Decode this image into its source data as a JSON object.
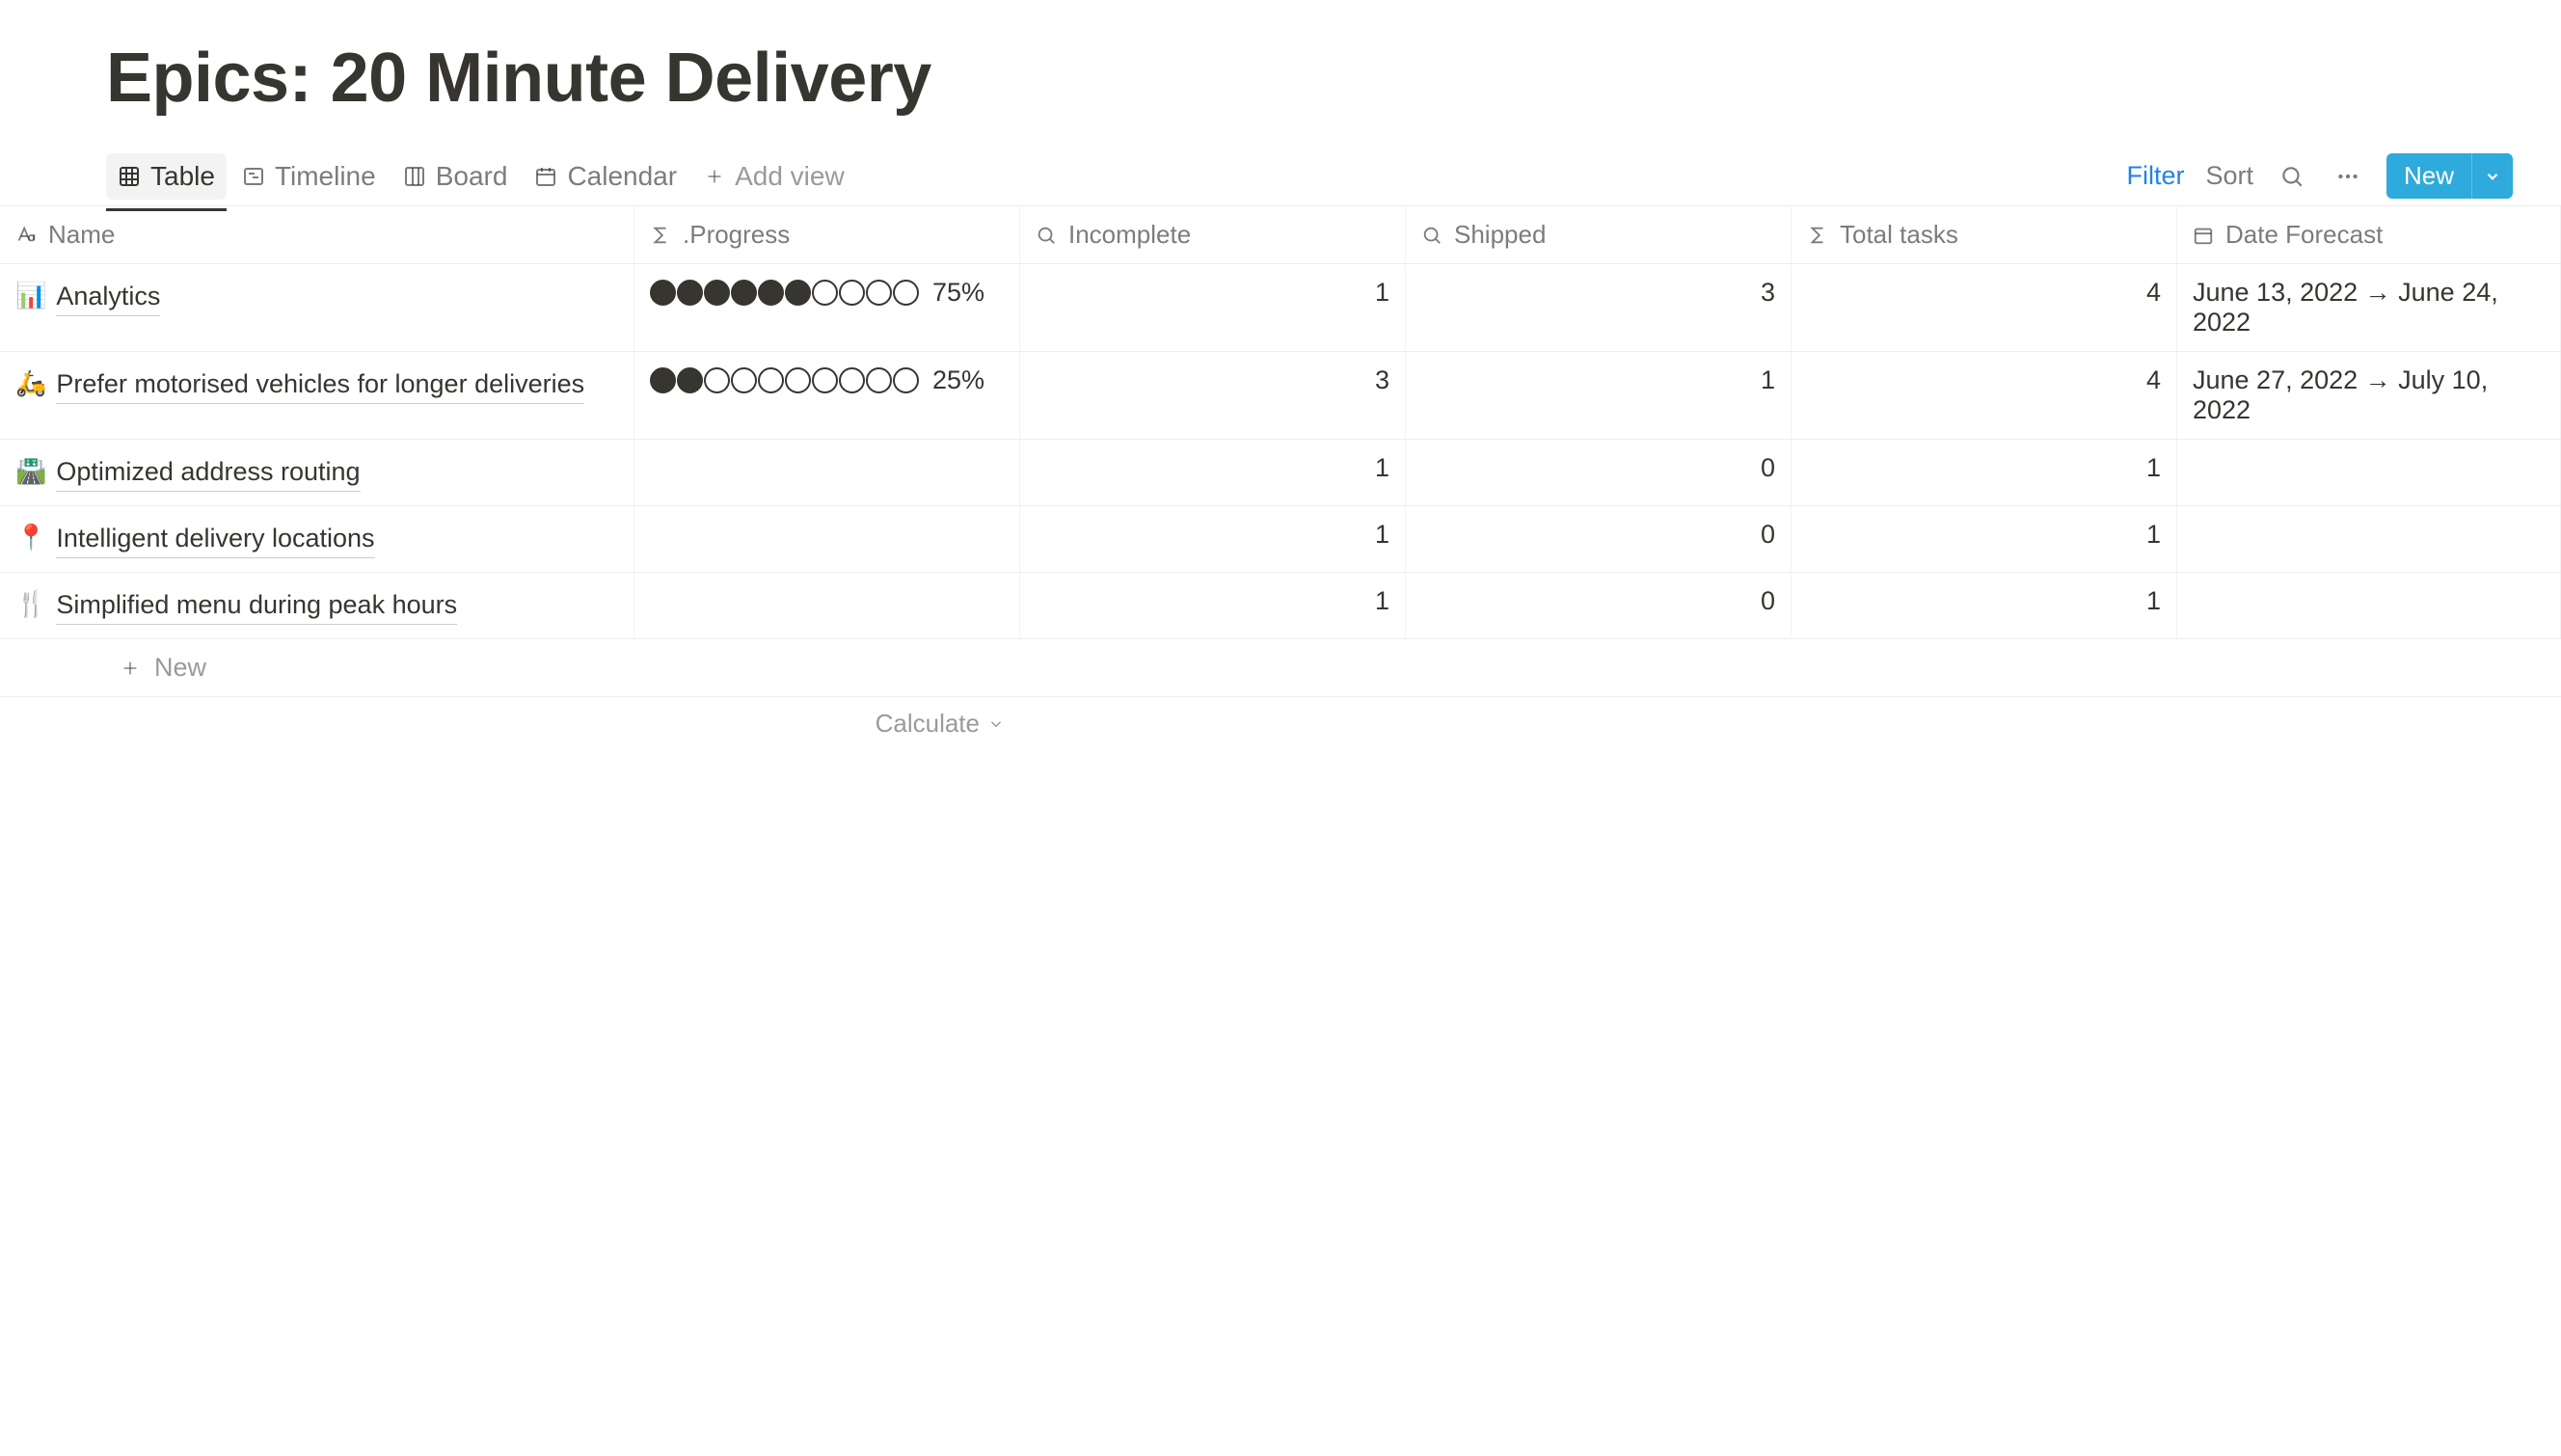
{
  "title": "Epics: 20 Minute Delivery",
  "tabs": [
    {
      "label": "Table",
      "active": true
    },
    {
      "label": "Timeline",
      "active": false
    },
    {
      "label": "Board",
      "active": false
    },
    {
      "label": "Calendar",
      "active": false
    }
  ],
  "addViewLabel": "Add view",
  "actions": {
    "filter": "Filter",
    "sort": "Sort",
    "new": "New"
  },
  "columns": {
    "name": "Name",
    "progress": ".Progress",
    "incomplete": "Incomplete",
    "shipped": "Shipped",
    "total": "Total tasks",
    "date": "Date Forecast"
  },
  "rows": [
    {
      "emoji": "📊",
      "name": "Analytics",
      "progressFilled": 6,
      "progressTotal": 10,
      "progressPct": "75%",
      "incomplete": "1",
      "shipped": "3",
      "total": "4",
      "date": "June 13, 2022 → June 24, 2022"
    },
    {
      "emoji": "🛵",
      "name": "Prefer motorised vehicles for longer deliveries",
      "progressFilled": 2,
      "progressTotal": 10,
      "progressPct": "25%",
      "incomplete": "3",
      "shipped": "1",
      "total": "4",
      "date": "June 27, 2022 → July 10, 2022"
    },
    {
      "emoji": "🛣️",
      "name": "Optimized address routing",
      "progressFilled": null,
      "progressTotal": null,
      "progressPct": "",
      "incomplete": "1",
      "shipped": "0",
      "total": "1",
      "date": ""
    },
    {
      "emoji": "📍",
      "name": "Intelligent delivery locations",
      "progressFilled": null,
      "progressTotal": null,
      "progressPct": "",
      "incomplete": "1",
      "shipped": "0",
      "total": "1",
      "date": ""
    },
    {
      "emoji": "🍴",
      "name": "Simplified menu during peak hours",
      "progressFilled": null,
      "progressTotal": null,
      "progressPct": "",
      "incomplete": "1",
      "shipped": "0",
      "total": "1",
      "date": ""
    }
  ],
  "newRowLabel": "New",
  "calculateLabel": "Calculate"
}
